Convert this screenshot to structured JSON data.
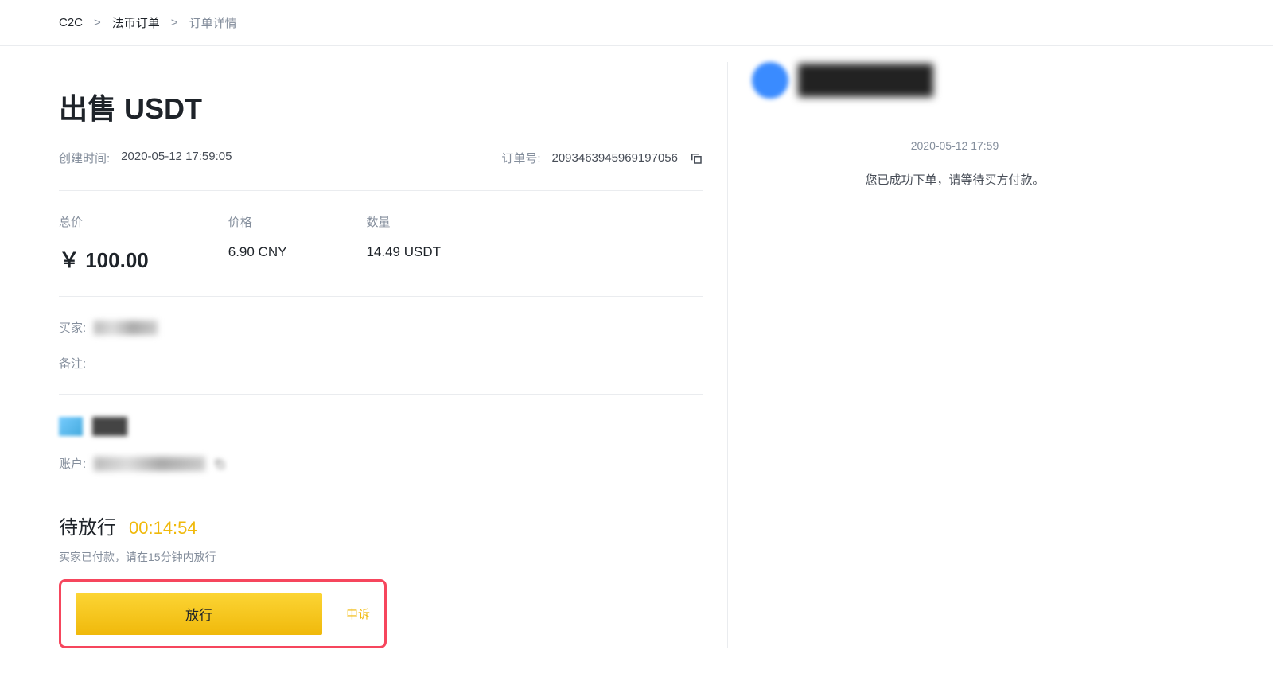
{
  "breadcrumb": {
    "item1": "C2C",
    "item2": "法币订单",
    "item3": "订单详情"
  },
  "title": "出售 USDT",
  "meta": {
    "created_label": "创建时间:",
    "created_value": "2020-05-12 17:59:05",
    "order_label": "订单号:",
    "order_value": "2093463945969197056"
  },
  "totals": {
    "price_total_label": "总价",
    "price_total_value": "￥ 100.00",
    "unit_price_label": "价格",
    "unit_price_value": "6.90 CNY",
    "amount_label": "数量",
    "amount_value": "14.49 USDT"
  },
  "buyer": {
    "label": "买家:",
    "remark_label": "备注:"
  },
  "account": {
    "label": "账户:"
  },
  "status": {
    "title": "待放行",
    "countdown": "00:14:54",
    "hint": "买家已付款，请在15分钟内放行"
  },
  "actions": {
    "release": "放行",
    "appeal": "申诉"
  },
  "chat": {
    "time": "2020-05-12 17:59",
    "message": "您已成功下单，请等待买方付款。"
  }
}
